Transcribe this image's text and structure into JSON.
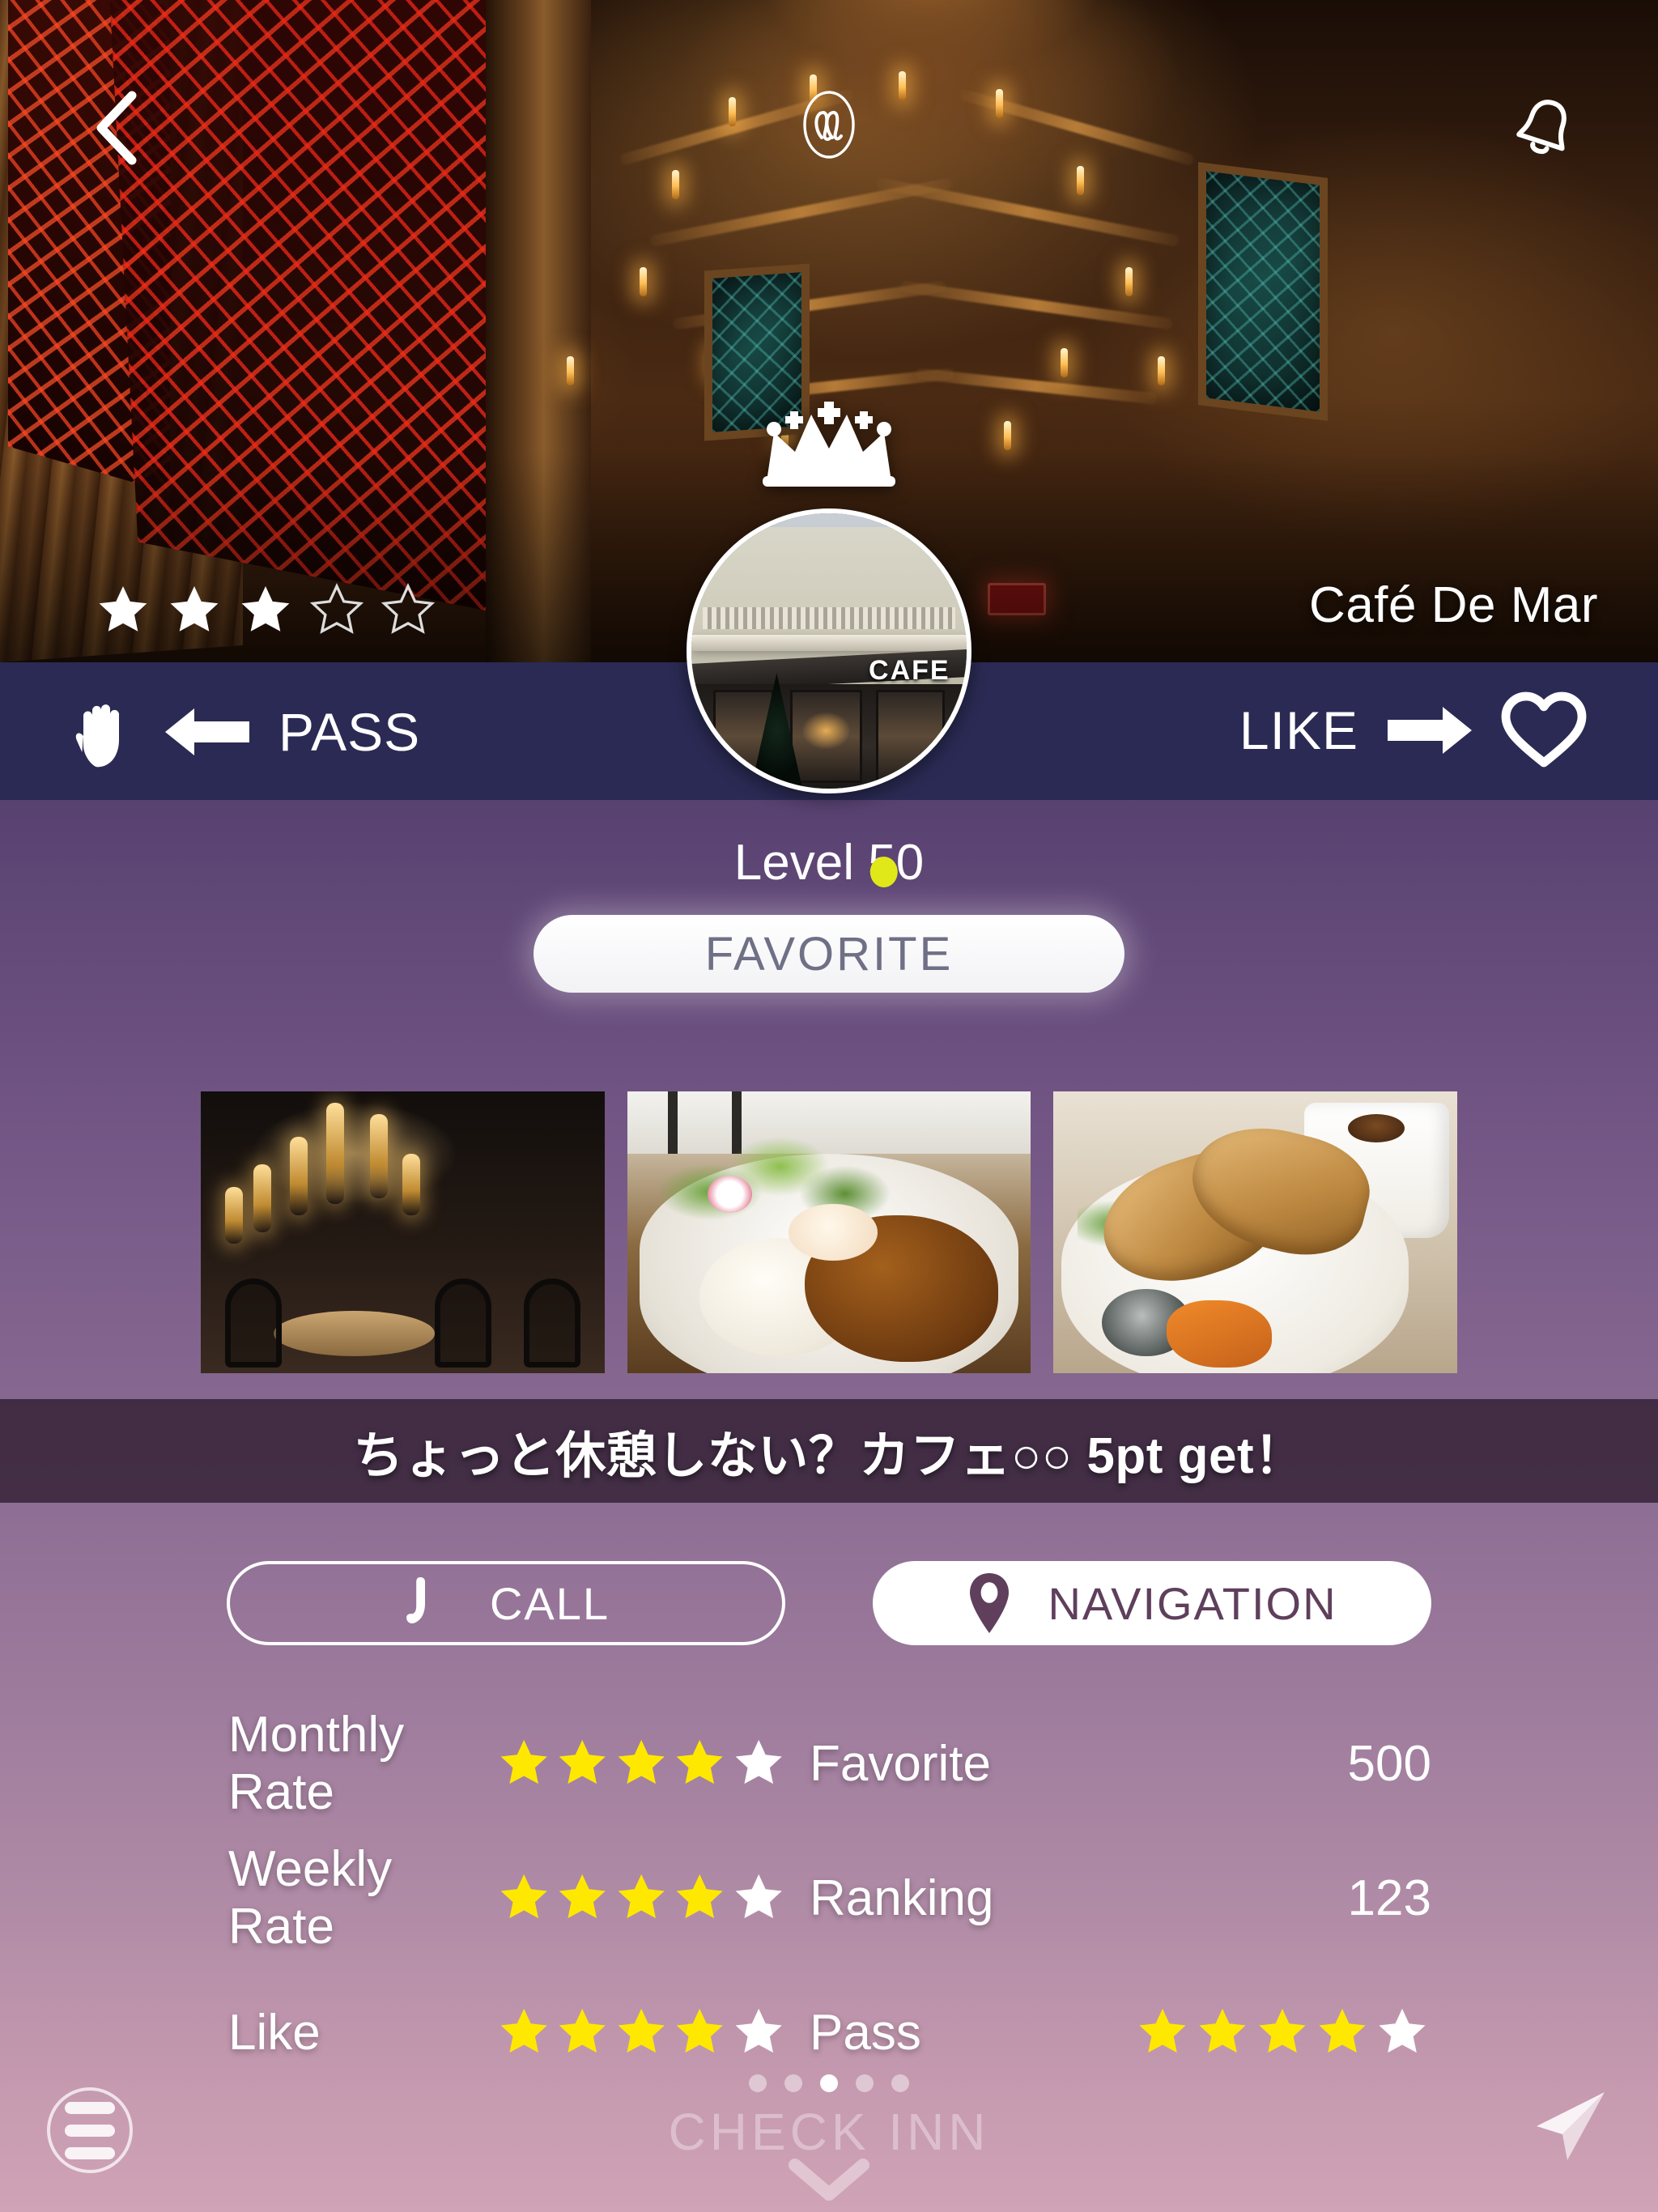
{
  "header": {
    "back_icon": "chevron-left-icon",
    "brand_icon": "brand-monogram-icon",
    "bell_icon": "bell-icon"
  },
  "hero": {
    "venue_name": "Café De Mar",
    "rating_filled": 3,
    "rating_total": 5,
    "crown_icon": "crown-icon",
    "avatar_sign_text": "CAFE"
  },
  "swipe": {
    "pass_label": "PASS",
    "pass_icon": "hand-icon",
    "pass_arrow_icon": "arrow-left-icon",
    "like_label": "LIKE",
    "like_arrow_icon": "arrow-right-icon",
    "like_icon": "heart-outline-icon",
    "background_color": "#2a2a54"
  },
  "profile": {
    "level_text": "Level 50",
    "favorite_button_label": "FAVORITE"
  },
  "gallery": {
    "photos": [
      {
        "alt": "restaurant-interior"
      },
      {
        "alt": "rice-curry-dish"
      },
      {
        "alt": "sandwich-and-coffee"
      }
    ]
  },
  "promo": {
    "text": "ちょっと休憩しない？カフェ○○ 5pt get！"
  },
  "actions": {
    "call_label": "CALL",
    "call_icon": "phone-icon",
    "navigation_label": "NAVIGATION",
    "navigation_icon": "map-pin-icon"
  },
  "stats": {
    "star_color": "#ffe800",
    "star_empty_color": "#ffffff",
    "rows": [
      {
        "left_label": "Monthly Rate",
        "left_stars_filled": 4,
        "left_stars_total": 5,
        "right_label": "Favorite",
        "right_value": "500",
        "right_is_stars": false
      },
      {
        "left_label": "Weekly Rate",
        "left_stars_filled": 4,
        "left_stars_total": 5,
        "right_label": "Ranking",
        "right_value": "123",
        "right_is_stars": false
      },
      {
        "left_label": "Like",
        "left_stars_filled": 4,
        "left_stars_total": 5,
        "right_label": "Pass",
        "right_stars_filled": 4,
        "right_stars_total": 5,
        "right_is_stars": true
      }
    ]
  },
  "bottom": {
    "menu_icon": "hamburger-menu-icon",
    "send_icon": "paper-plane-icon",
    "brand_text": "CHECK INN",
    "chevron_icon": "chevron-down-icon",
    "page_dots": 5,
    "page_dot_active_index": 2
  }
}
